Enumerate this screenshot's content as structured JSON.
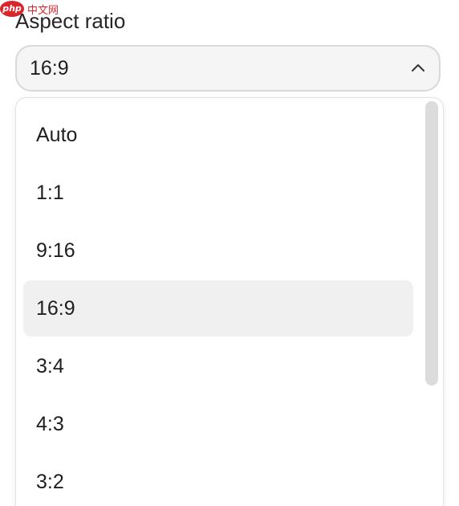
{
  "watermark": {
    "logo_text": "php",
    "site_text": "中文网"
  },
  "field": {
    "label": "Aspect ratio",
    "selected_value": "16:9",
    "expanded": true
  },
  "icons": {
    "chevron": "chevron-up-icon"
  },
  "dropdown": {
    "options": [
      {
        "label": "Auto",
        "selected": false
      },
      {
        "label": "1:1",
        "selected": false
      },
      {
        "label": "9:16",
        "selected": false
      },
      {
        "label": "16:9",
        "selected": true
      },
      {
        "label": "3:4",
        "selected": false
      },
      {
        "label": "4:3",
        "selected": false
      },
      {
        "label": "3:2",
        "selected": false
      }
    ],
    "selected_highlight_color": "#f0f0f0",
    "scrollbar_color": "#dcdcdc"
  }
}
